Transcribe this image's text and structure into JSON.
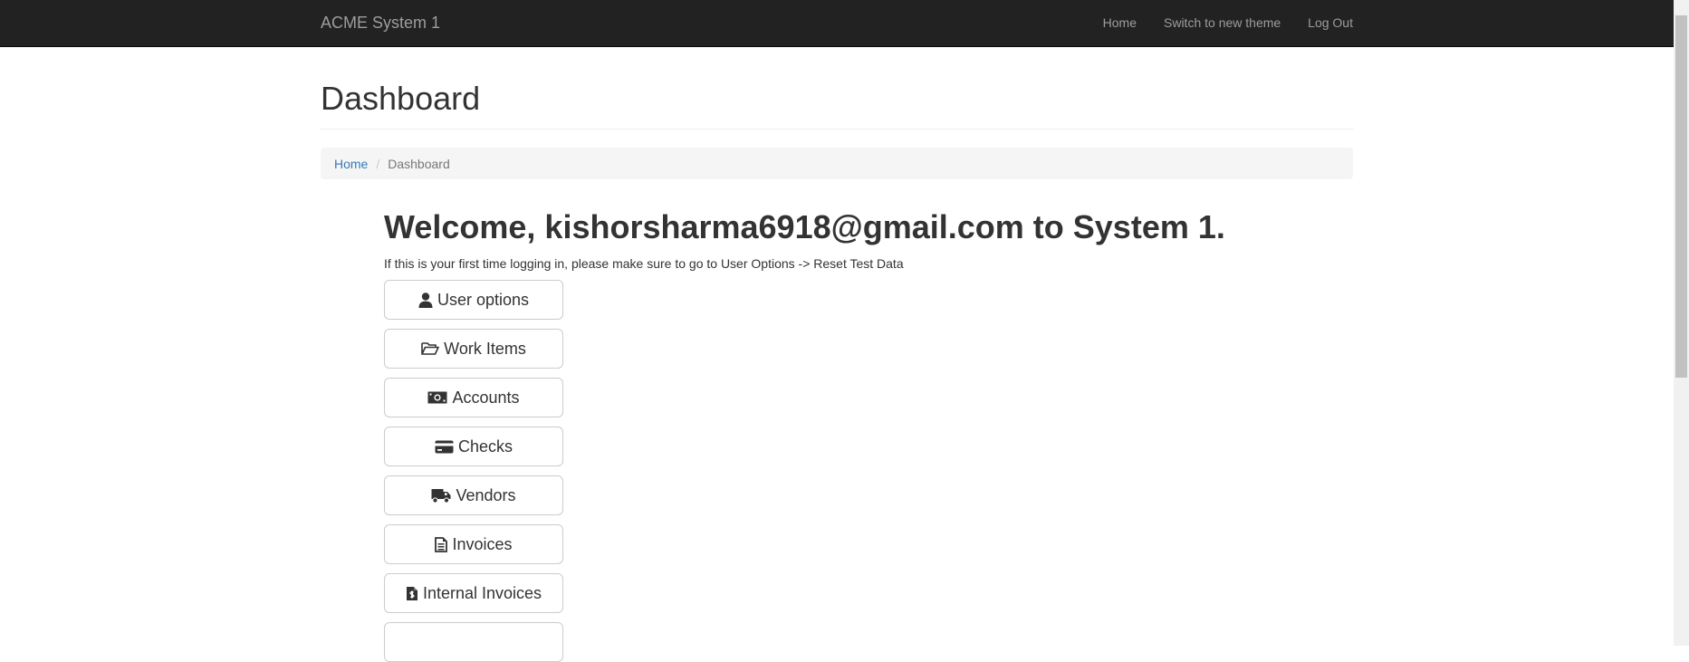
{
  "navbar": {
    "brand": "ACME System 1",
    "links": [
      "Home",
      "Switch to new theme",
      "Log Out"
    ]
  },
  "page": {
    "title": "Dashboard"
  },
  "breadcrumb": {
    "home": "Home",
    "separator": "/",
    "current": "Dashboard"
  },
  "welcome": {
    "prefix": "Welcome,",
    "email": "kishorsharma6918@gmail.com",
    "suffix": "to System 1.",
    "hint": "If this is your first time logging in, please make sure to go to User Options -> Reset Test Data"
  },
  "buttons": [
    {
      "label": "User options",
      "icon": "user-icon"
    },
    {
      "label": "Work Items",
      "icon": "folder-open-icon"
    },
    {
      "label": "Accounts",
      "icon": "money-icon"
    },
    {
      "label": "Checks",
      "icon": "credit-card-icon"
    },
    {
      "label": "Vendors",
      "icon": "truck-icon"
    },
    {
      "label": "Invoices",
      "icon": "file-text-icon"
    },
    {
      "label": "Internal Invoices",
      "icon": "file-invoice-icon"
    }
  ],
  "colors": {
    "navbar_bg": "#222222",
    "navbar_text": "#9d9d9d",
    "link": "#337ab7",
    "breadcrumb_bg": "#f5f5f5"
  }
}
